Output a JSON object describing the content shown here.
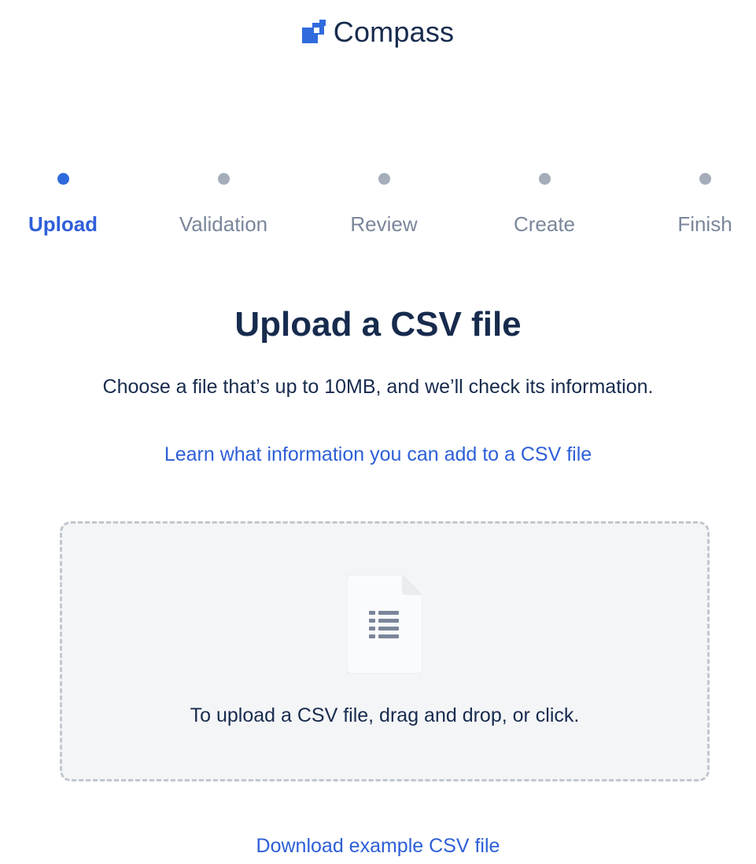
{
  "brand": {
    "name": "Compass",
    "logo_icon": "compass-logo-icon",
    "logo_color": "#2F6BDD"
  },
  "stepper": {
    "steps": [
      {
        "label": "Upload",
        "active": true
      },
      {
        "label": "Validation",
        "active": false
      },
      {
        "label": "Review",
        "active": false
      },
      {
        "label": "Create",
        "active": false
      },
      {
        "label": "Finish",
        "active": false
      }
    ],
    "active_color": "#2F6BDD",
    "inactive_color": "#A5ADBA"
  },
  "main": {
    "title": "Upload a CSV file",
    "subtitle": "Choose a file that’s up to 10MB, and we’ll check its information.",
    "learn_link": "Learn what information you can add to a CSV file"
  },
  "dropzone": {
    "icon": "file-list-icon",
    "instruction": "To upload a CSV file, drag and drop, or click."
  },
  "footer": {
    "download_link": "Download example CSV file"
  }
}
